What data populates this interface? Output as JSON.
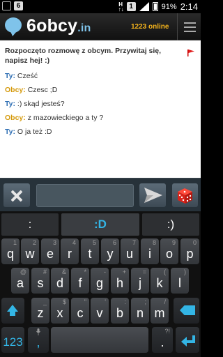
{
  "status_bar": {
    "notification_badge": "6",
    "network": "H",
    "sim_badge": "1",
    "battery": "91%",
    "time": "2:14"
  },
  "app": {
    "logo_main": "6obcy",
    "logo_suffix": ".in",
    "online_count": "1223 online",
    "accent_color": "#7fc3ea"
  },
  "chat": {
    "system_message": "Rozpoczęto rozmowę z obcym. Przywitaj się, napisz hej! :)",
    "messages": [
      {
        "author": "Ty:",
        "text": "Cześć"
      },
      {
        "author": "Obcy:",
        "text": "Czesc ;D"
      },
      {
        "author": "Ty:",
        "text": ":) skąd jesteś?"
      },
      {
        "author": "Obcy:",
        "text": "z mazowieckiego a ty ?"
      },
      {
        "author": "Ty:",
        "text": "O ja też :D"
      }
    ]
  },
  "input": {
    "value": "",
    "placeholder": ""
  },
  "keyboard": {
    "suggestions": [
      ":",
      ":D",
      ":)"
    ],
    "row1": [
      {
        "key": "q",
        "alt": "1"
      },
      {
        "key": "w",
        "alt": "2"
      },
      {
        "key": "e",
        "alt": "3"
      },
      {
        "key": "r",
        "alt": "4"
      },
      {
        "key": "t",
        "alt": "5"
      },
      {
        "key": "y",
        "alt": "6"
      },
      {
        "key": "u",
        "alt": "7"
      },
      {
        "key": "i",
        "alt": "8"
      },
      {
        "key": "o",
        "alt": "9"
      },
      {
        "key": "p",
        "alt": "0"
      }
    ],
    "row2": [
      {
        "key": "a",
        "alt": "@"
      },
      {
        "key": "s",
        "alt": "#"
      },
      {
        "key": "d",
        "alt": "&"
      },
      {
        "key": "f",
        "alt": "*"
      },
      {
        "key": "g",
        "alt": "-"
      },
      {
        "key": "h",
        "alt": "+"
      },
      {
        "key": "j",
        "alt": "="
      },
      {
        "key": "k",
        "alt": "("
      },
      {
        "key": "l",
        "alt": ")"
      }
    ],
    "row3": [
      {
        "key": "z",
        "alt": "_"
      },
      {
        "key": "x",
        "alt": "$"
      },
      {
        "key": "c",
        "alt": "\""
      },
      {
        "key": "v",
        "alt": "'"
      },
      {
        "key": "b",
        "alt": ":"
      },
      {
        "key": "n",
        "alt": ";"
      },
      {
        "key": "m",
        "alt": "/"
      }
    ],
    "numbers_label": "123",
    "comma": ",",
    "period": ".",
    "period_alt": "?!"
  }
}
